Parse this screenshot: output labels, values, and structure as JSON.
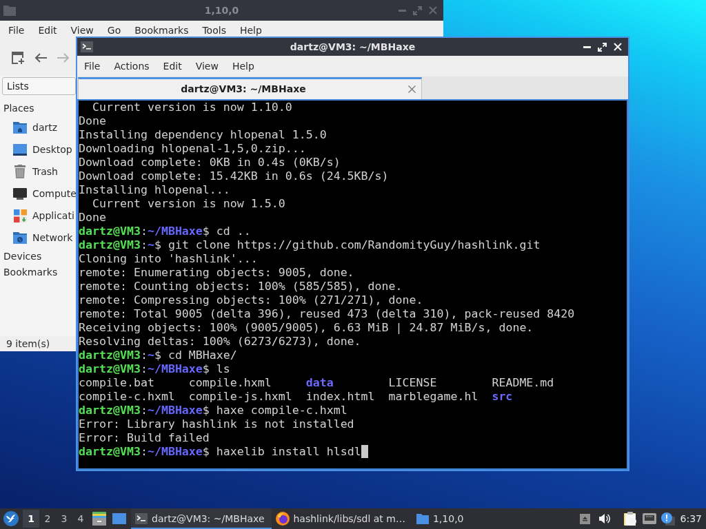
{
  "file_manager": {
    "title": "1,10,0",
    "active": false,
    "menu": [
      "File",
      "Edit",
      "View",
      "Go",
      "Bookmarks",
      "Tools",
      "Help"
    ],
    "toolbar": [
      {
        "kind": "new-tab",
        "disabled": false
      },
      {
        "kind": "back",
        "disabled": false
      },
      {
        "kind": "forward",
        "disabled": true
      }
    ],
    "side_pane": {
      "mode": "Lists",
      "places_heading": "Places",
      "places": [
        {
          "label": "dartz",
          "kind": "home"
        },
        {
          "label": "Desktop",
          "kind": "desktop"
        },
        {
          "label": "Trash",
          "kind": "trash"
        },
        {
          "label": "Compute",
          "kind": "computer"
        },
        {
          "label": "Applicati",
          "kind": "applications"
        },
        {
          "label": "Network",
          "kind": "network"
        }
      ],
      "sections": [
        "Devices",
        "Bookmarks"
      ]
    },
    "status": "9 item(s)"
  },
  "terminal": {
    "title": "dartz@VM3: ~/MBHaxe",
    "active": true,
    "menu": [
      "File",
      "Actions",
      "Edit",
      "View",
      "Help"
    ],
    "tabs": [
      {
        "label": "dartz@VM3: ~/MBHaxe",
        "selected": true
      }
    ],
    "lines": [
      {
        "kind": "output",
        "text": "  Current version is now 1.10.0"
      },
      {
        "kind": "output",
        "text": "Done"
      },
      {
        "kind": "output",
        "text": "Installing dependency hlopenal 1.5.0"
      },
      {
        "kind": "output",
        "text": "Downloading hlopenal-1,5,0.zip..."
      },
      {
        "kind": "output",
        "text": "Download complete: 0KB in 0.4s (0KB/s)"
      },
      {
        "kind": "output",
        "text": "Download complete: 15.42KB in 0.6s (24.5KB/s)"
      },
      {
        "kind": "output",
        "text": "Installing hlopenal..."
      },
      {
        "kind": "output",
        "text": "  Current version is now 1.5.0"
      },
      {
        "kind": "output",
        "text": "Done"
      },
      {
        "kind": "prompt",
        "user": "dartz@VM3",
        "sep": ":",
        "path": "~/MBHaxe",
        "input": "$ cd .."
      },
      {
        "kind": "prompt",
        "user": "dartz@VM3",
        "sep": ":",
        "path": "~",
        "input": "$ git clone https://github.com/RandomityGuy/hashlink.git"
      },
      {
        "kind": "output",
        "text": "Cloning into 'hashlink'..."
      },
      {
        "kind": "output",
        "text": "remote: Enumerating objects: 9005, done."
      },
      {
        "kind": "output",
        "text": "remote: Counting objects: 100% (585/585), done."
      },
      {
        "kind": "output",
        "text": "remote: Compressing objects: 100% (271/271), done."
      },
      {
        "kind": "output",
        "text": "remote: Total 9005 (delta 396), reused 473 (delta 310), pack-reused 8420"
      },
      {
        "kind": "output",
        "text": "Receiving objects: 100% (9005/9005), 6.63 MiB | 24.87 MiB/s, done."
      },
      {
        "kind": "output",
        "text": "Resolving deltas: 100% (6273/6273), done."
      },
      {
        "kind": "prompt",
        "user": "dartz@VM3",
        "sep": ":",
        "path": "~",
        "input": "$ cd MBHaxe/"
      },
      {
        "kind": "prompt",
        "user": "dartz@VM3",
        "sep": ":",
        "path": "~/MBHaxe",
        "input": "$ ls"
      },
      {
        "kind": "listing",
        "entries": [
          {
            "name": "compile.bat",
            "kind": "file"
          },
          {
            "name": "compile.hxml",
            "kind": "file"
          },
          {
            "name": "data",
            "kind": "directory"
          },
          {
            "name": "LICENSE",
            "kind": "file"
          },
          {
            "name": "README.md",
            "kind": "file"
          }
        ]
      },
      {
        "kind": "listing",
        "entries": [
          {
            "name": "compile-c.hxml",
            "kind": "file"
          },
          {
            "name": "compile-js.hxml",
            "kind": "file"
          },
          {
            "name": "index.html",
            "kind": "file"
          },
          {
            "name": "marblegame.hl",
            "kind": "file"
          },
          {
            "name": "src",
            "kind": "directory"
          }
        ]
      },
      {
        "kind": "prompt",
        "user": "dartz@VM3",
        "sep": ":",
        "path": "~/MBHaxe",
        "input": "$ haxe compile-c.hxml"
      },
      {
        "kind": "output",
        "text": "Error: Library hashlink is not installed"
      },
      {
        "kind": "output",
        "text": "Error: Build failed"
      },
      {
        "kind": "prompt",
        "user": "dartz@VM3",
        "sep": ":",
        "path": "~/MBHaxe",
        "input": "$ haxelib install hlsdl"
      }
    ],
    "cursor": true
  },
  "taskbar": {
    "workspaces": [
      {
        "label": "1",
        "selected": true
      },
      {
        "label": "2",
        "selected": false
      },
      {
        "label": "3",
        "selected": false
      },
      {
        "label": "4",
        "selected": false
      }
    ],
    "tasks": [
      {
        "label": "dartz@VM3: ~/MBHaxe",
        "kind": "terminal",
        "selected": true
      },
      {
        "label": "hashlink/libs/sdl at m…",
        "kind": "browser",
        "selected": false
      },
      {
        "label": "1,10,0",
        "kind": "folder",
        "selected": false
      }
    ],
    "clock": "6:37"
  }
}
